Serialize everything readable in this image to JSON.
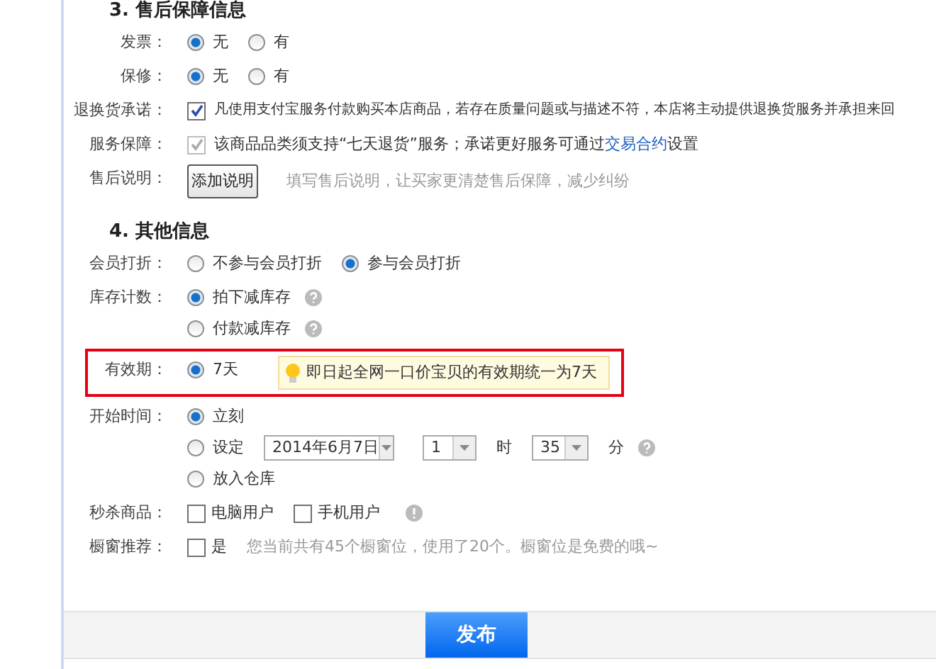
{
  "sections": [
    {
      "title": "3. 售后保障信息",
      "rows": [
        {
          "label": "发票：",
          "kind": "radio_inline",
          "highlighted": false,
          "options": [
            {
              "label": "无",
              "selected": true
            },
            {
              "label": "有",
              "selected": false
            }
          ]
        },
        {
          "label": "保修：",
          "kind": "radio_inline",
          "highlighted": false,
          "options": [
            {
              "label": "无",
              "selected": true
            },
            {
              "label": "有",
              "selected": false
            }
          ]
        },
        {
          "label": "退换货承诺：",
          "kind": "checkline",
          "highlighted": false,
          "checked": true,
          "disabled": false,
          "text": "凡使用支付宝服务付款购买本店商品，若存在质量问题或与描述不符，本店将主动提供退换货服务并承担来回"
        },
        {
          "label": "服务保障：",
          "kind": "checkline",
          "highlighted": false,
          "checked": true,
          "disabled": true,
          "text": "该商品品类须支持“七天退货”服务；承诺更好服务可通过",
          "link": "交易合约",
          "text_after": "设置"
        },
        {
          "label": "售后说明：",
          "kind": "button",
          "highlighted": false,
          "button": "添加说明",
          "hint": "填写售后说明，让买家更清楚售后保障，减少纠纷"
        }
      ]
    },
    {
      "title": "4. 其他信息",
      "rows": [
        {
          "label": "会员打折：",
          "kind": "radio_inline",
          "highlighted": false,
          "options": [
            {
              "label": "不参与会员打折",
              "selected": false
            },
            {
              "label": "参与会员打折",
              "selected": true
            }
          ]
        },
        {
          "label": "库存计数：",
          "kind": "radio_stacked",
          "highlighted": false,
          "options": [
            {
              "label": "拍下减库存",
              "selected": true,
              "help": true
            },
            {
              "label": "付款减库存",
              "selected": false,
              "help": true
            }
          ]
        },
        {
          "label": "有效期：",
          "kind": "radio_inline",
          "highlighted": true,
          "options": [
            {
              "label": "7天",
              "selected": true
            }
          ],
          "tip": "即日起全网一口价宝贝的有效期统一为7天"
        },
        {
          "label": "开始时间：",
          "kind": "radio_stacked",
          "highlighted": false,
          "options": [
            {
              "label": "立刻",
              "selected": true
            },
            {
              "label": "设定",
              "selected": false,
              "date": "2014年6月7日",
              "hour": "1",
              "hour_unit": "时",
              "minute": "35",
              "minute_unit": "分",
              "help": true
            },
            {
              "label": "放入仓库",
              "selected": false
            }
          ]
        },
        {
          "label": "秒杀商品：",
          "kind": "check_inline",
          "highlighted": false,
          "info": true,
          "options": [
            {
              "label": "电脑用户",
              "checked": false
            },
            {
              "label": "手机用户",
              "checked": false
            }
          ]
        },
        {
          "label": "橱窗推荐：",
          "kind": "check_inline",
          "highlighted": false,
          "options": [
            {
              "label": "是",
              "checked": false
            }
          ],
          "hint": "您当前共有45个橱窗位，使用了20个。橱窗位是免费的哦~"
        }
      ]
    }
  ],
  "submit": "发布"
}
